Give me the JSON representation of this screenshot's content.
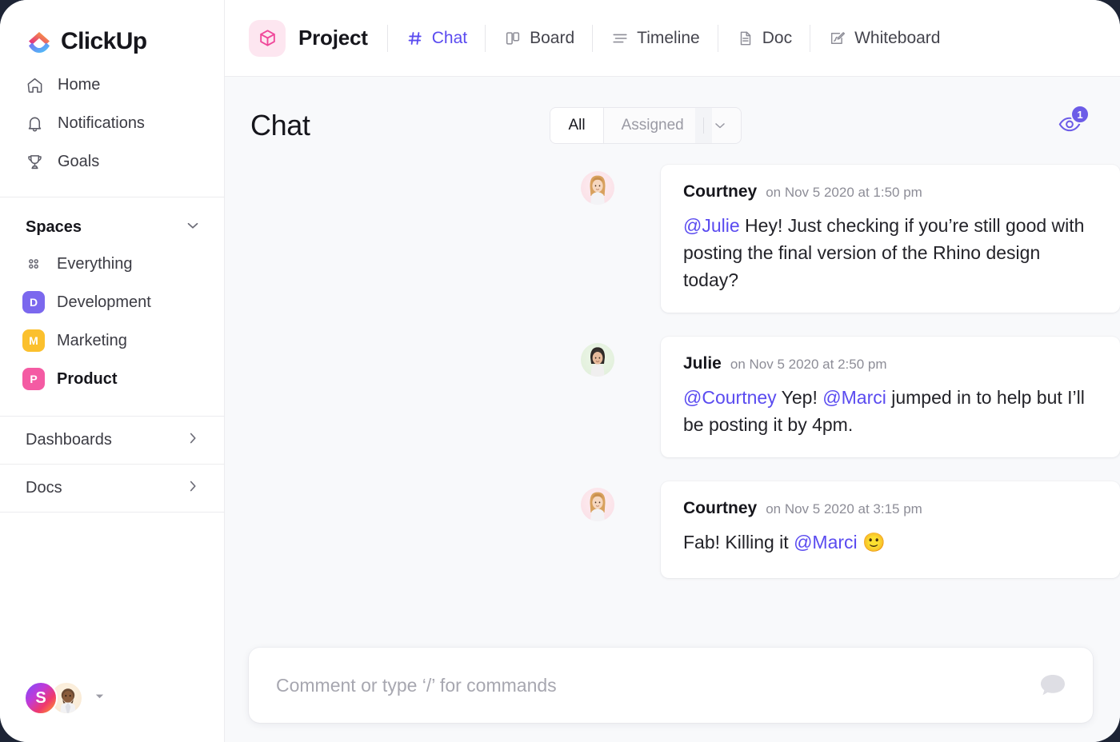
{
  "brand": {
    "name": "ClickUp",
    "accent": "#5a4bf0",
    "badge_purple": "#6c5ce7"
  },
  "sidebar": {
    "nav": [
      {
        "label": "Home",
        "icon": "home-icon"
      },
      {
        "label": "Notifications",
        "icon": "bell-icon"
      },
      {
        "label": "Goals",
        "icon": "trophy-icon"
      }
    ],
    "spaces": {
      "title": "Spaces",
      "collapse_icon": "chevron-down-icon",
      "items": [
        {
          "label": "Everything",
          "type": "grid",
          "icon": "grid-icon"
        },
        {
          "label": "Development",
          "type": "space",
          "initial": "D",
          "color": "#7b68ee"
        },
        {
          "label": "Marketing",
          "type": "space",
          "initial": "M",
          "color": "#fbc02d"
        },
        {
          "label": "Product",
          "type": "space",
          "initial": "P",
          "color": "#f45ba3",
          "active": true
        }
      ]
    },
    "links": [
      {
        "label": "Dashboards",
        "icon": "chevron-right-icon"
      },
      {
        "label": "Docs",
        "icon": "chevron-right-icon"
      }
    ],
    "user": {
      "initial": "S",
      "avatar_count": 2,
      "caret_icon": "caret-down-icon"
    }
  },
  "topbar": {
    "project_icon": "cube-icon",
    "project_name": "Project",
    "tabs": [
      {
        "label": "Chat",
        "icon": "hash-icon",
        "active": true
      },
      {
        "label": "Board",
        "icon": "board-icon",
        "active": false
      },
      {
        "label": "Timeline",
        "icon": "timeline-icon",
        "active": false
      },
      {
        "label": "Doc",
        "icon": "doc-icon",
        "active": false
      },
      {
        "label": "Whiteboard",
        "icon": "whiteboard-icon",
        "active": false
      }
    ]
  },
  "chat": {
    "title": "Chat",
    "filter": {
      "all_label": "All",
      "assigned_label": "Assigned",
      "caret_icon": "chevron-down-icon",
      "selected": "All"
    },
    "watchers": {
      "count": "1",
      "icon": "eye-icon"
    },
    "messages": [
      {
        "author": "Courtney",
        "time": "on Nov 5 2020 at 1:50 pm",
        "avatar": "courtney",
        "parts": [
          {
            "t": "mention",
            "text": "@Julie"
          },
          {
            "t": "text",
            "text": " Hey! Just checking if you’re still good with posting the final version of the Rhino design today?"
          }
        ]
      },
      {
        "author": "Julie",
        "time": "on Nov 5 2020 at 2:50 pm",
        "avatar": "julie",
        "parts": [
          {
            "t": "mention",
            "text": "@Courtney"
          },
          {
            "t": "text",
            "text": " Yep! "
          },
          {
            "t": "mention",
            "text": "@Marci"
          },
          {
            "t": "text",
            "text": " jumped in to help but I’ll be posting it by 4pm."
          }
        ]
      },
      {
        "author": "Courtney",
        "time": "on Nov 5 2020 at 3:15 pm",
        "avatar": "courtney",
        "parts": [
          {
            "t": "text",
            "text": "Fab! Killing it "
          },
          {
            "t": "mention",
            "text": "@Marci"
          },
          {
            "t": "text",
            "text": " 🙂"
          }
        ]
      }
    ],
    "composer": {
      "placeholder": "Comment or type ‘/’ for commands",
      "send_icon": "comment-bubble-icon"
    }
  }
}
